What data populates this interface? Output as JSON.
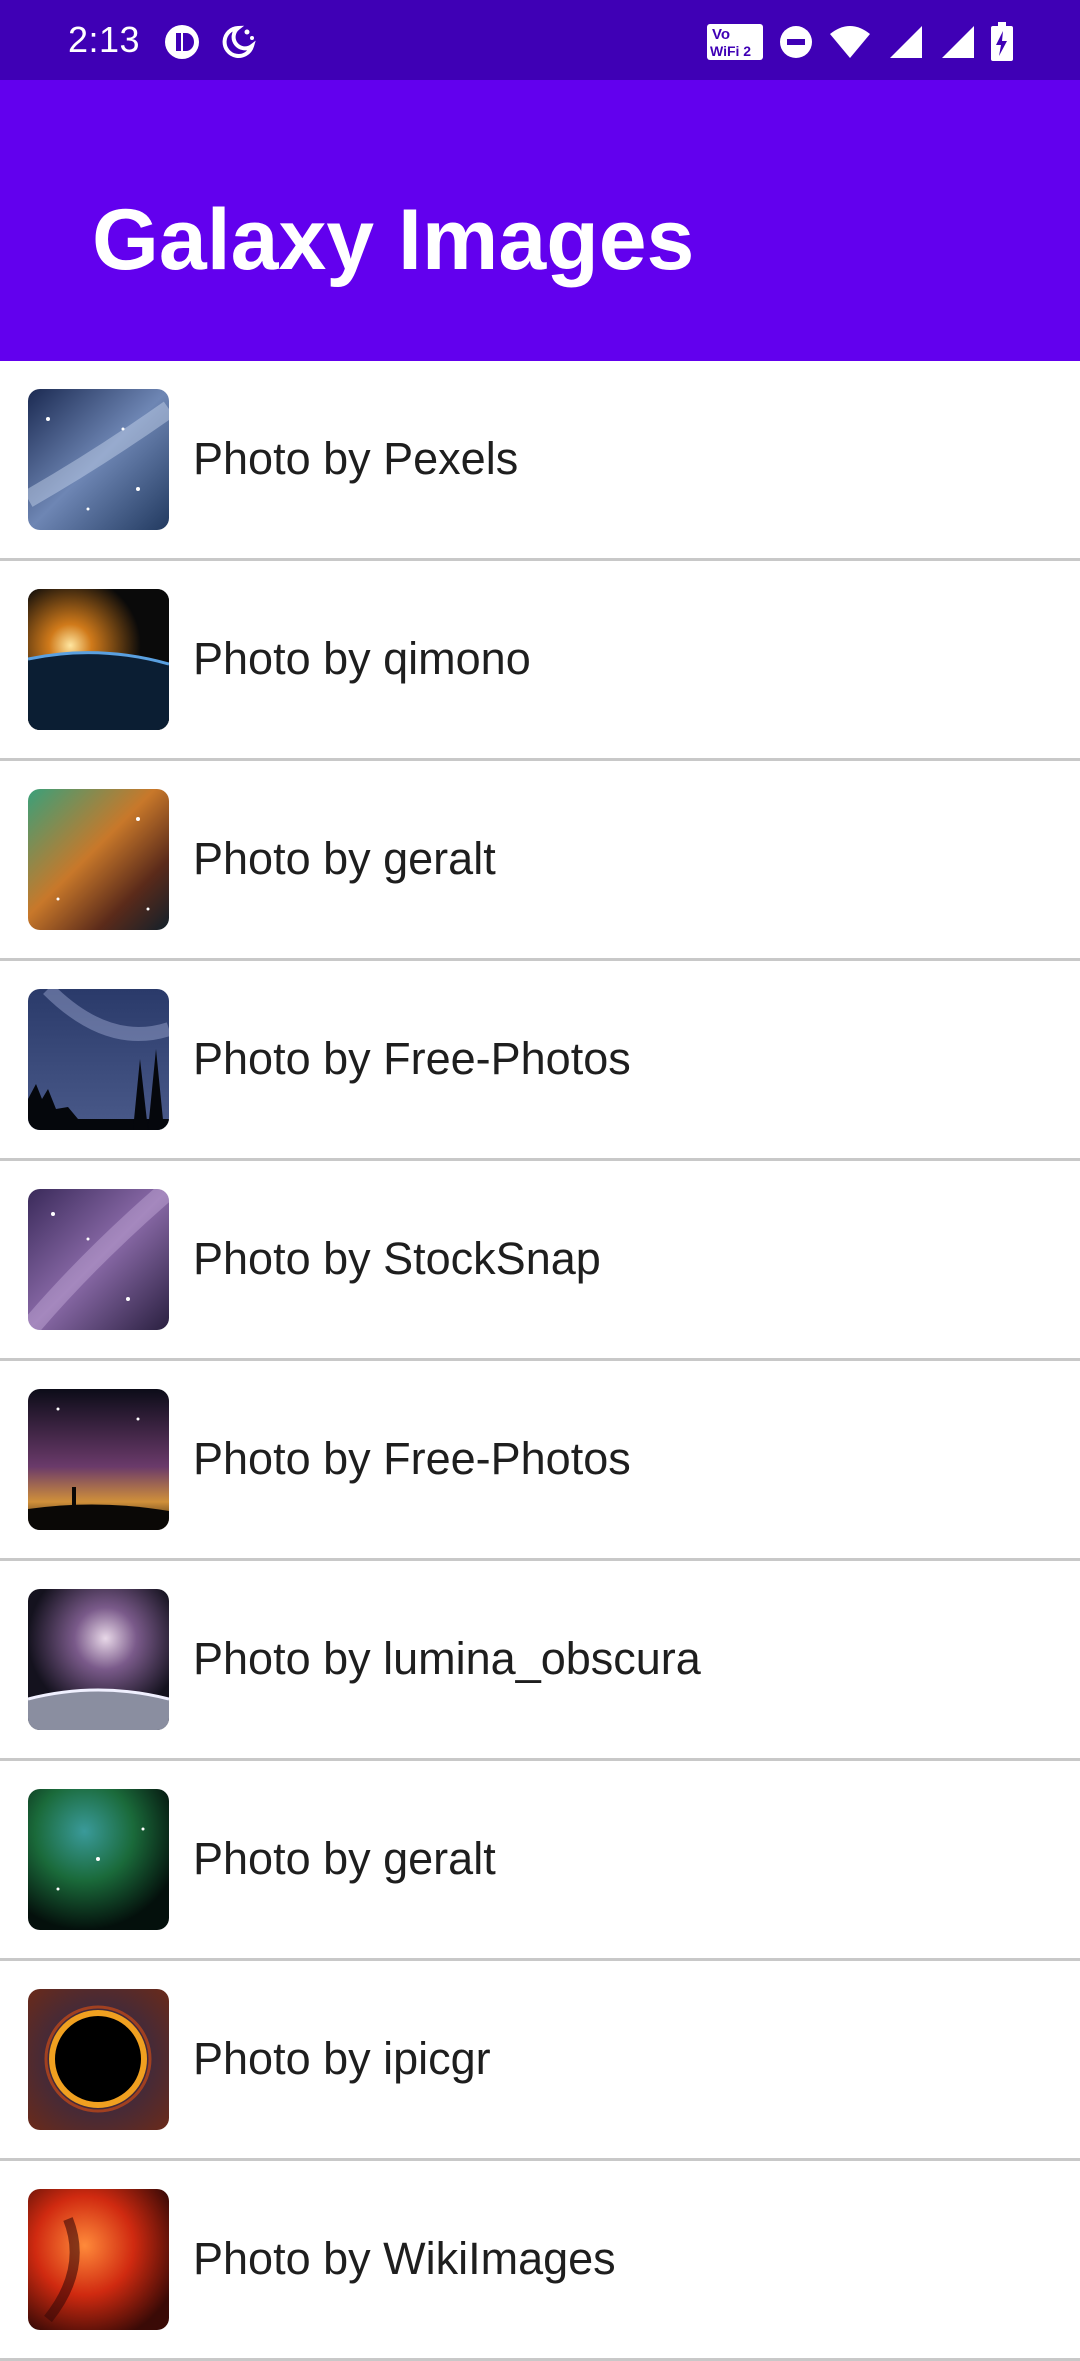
{
  "status_bar": {
    "time": "2:13",
    "wifi_calling_line1": "Vo",
    "wifi_calling_line2": "WiFi 2",
    "icons": [
      "media-app-icon",
      "night-mode-icon",
      "wifi-calling-icon",
      "do-not-disturb-icon",
      "wifi-icon",
      "signal-icon",
      "signal-icon-2",
      "battery-charging-icon"
    ]
  },
  "app_bar": {
    "title": "Galaxy Images"
  },
  "photos": [
    {
      "label": "Photo by Pexels",
      "thumb": "milky-way-blue"
    },
    {
      "label": "Photo by qimono",
      "thumb": "earth-sunrise"
    },
    {
      "label": "Photo by geralt",
      "thumb": "nebula-colorful"
    },
    {
      "label": "Photo by Free-Photos",
      "thumb": "milky-way-trees"
    },
    {
      "label": "Photo by StockSnap",
      "thumb": "milky-way-purple"
    },
    {
      "label": "Photo by Free-Photos",
      "thumb": "night-sky-person"
    },
    {
      "label": "Photo by lumina_obscura",
      "thumb": "galaxy-over-planet"
    },
    {
      "label": "Photo by geralt",
      "thumb": "green-nebula"
    },
    {
      "label": "Photo by ipicgr",
      "thumb": "eclipse-ring"
    },
    {
      "label": "Photo by WikiImages",
      "thumb": "red-nebula"
    }
  ],
  "colors": {
    "status_bar": "#3f00b5",
    "app_bar": "#6200ee",
    "divider": "#c8c8c8",
    "text": "#1e1e1e"
  }
}
